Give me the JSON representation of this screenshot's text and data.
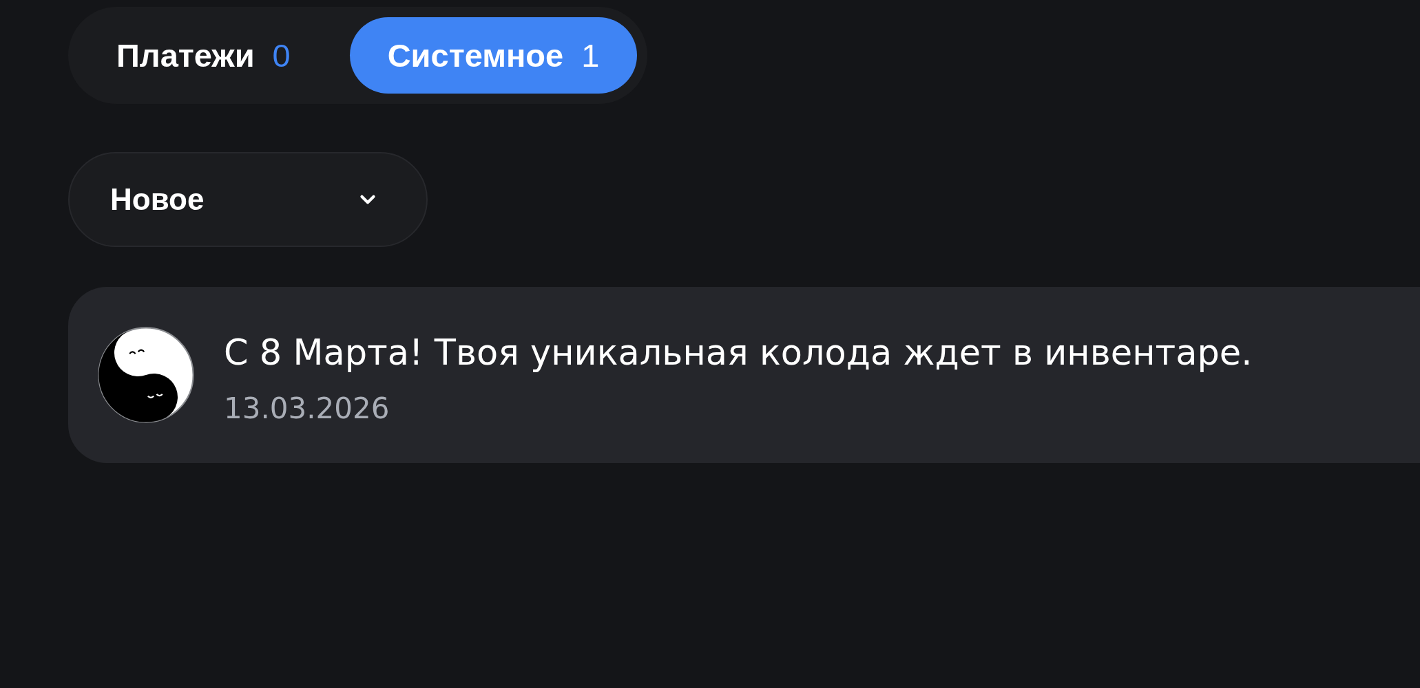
{
  "tabs": [
    {
      "label": "Платежи",
      "count": "0",
      "selected": false
    },
    {
      "label": "Системное",
      "count": "1",
      "selected": true
    }
  ],
  "sort_dropdown": {
    "value": "Новое"
  },
  "notifications": [
    {
      "message": "С 8 Марта! Твоя уникальная колода ждет в инвентаре.",
      "date": "13.03.2026"
    }
  ]
}
